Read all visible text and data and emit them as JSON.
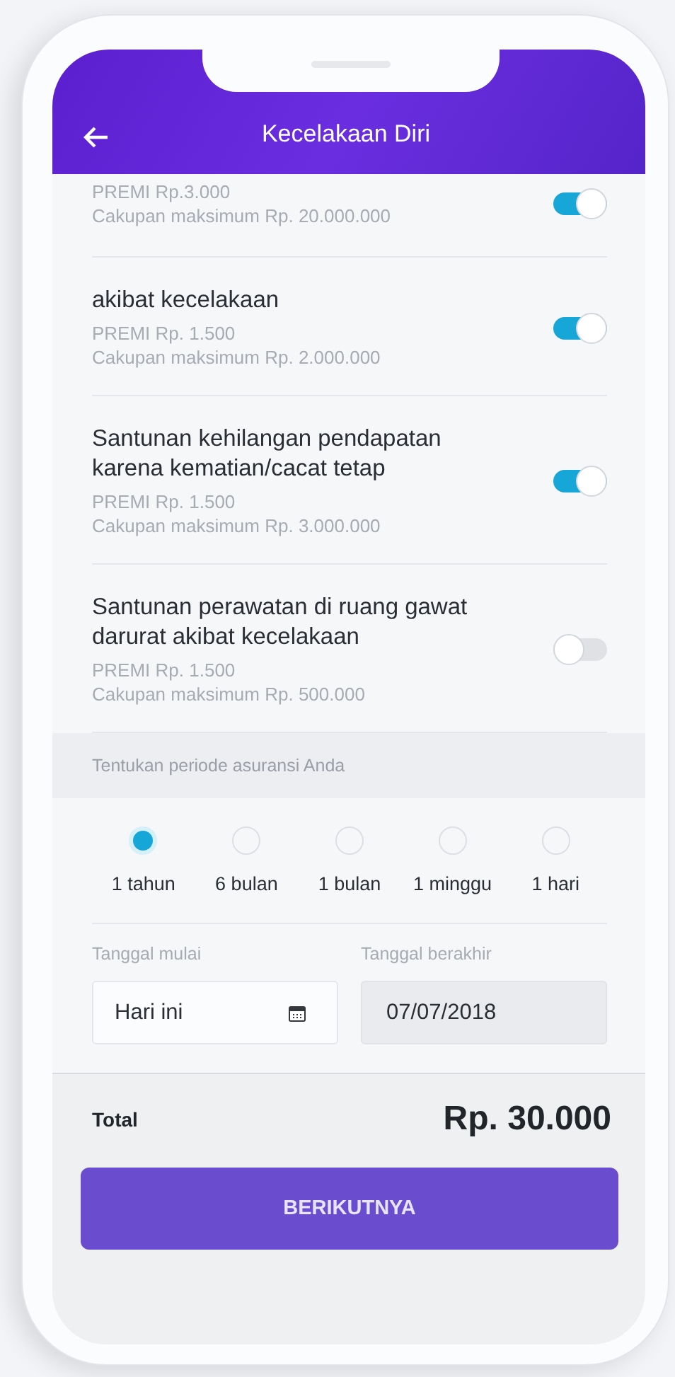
{
  "header": {
    "title": "Kecelakaan Diri"
  },
  "coverages": [
    {
      "premium": "PREMI Rp.3.000",
      "coverage": "Cakupan maksimum Rp. 20.000.000",
      "on": true
    },
    {
      "title": "akibat kecelakaan",
      "premium": "PREMI Rp. 1.500",
      "coverage": "Cakupan maksimum Rp. 2.000.000",
      "on": true
    },
    {
      "title": "Santunan kehilangan pendapatan karena kematian/cacat tetap",
      "premium": "PREMI Rp. 1.500",
      "coverage": "Cakupan maksimum Rp. 3.000.000",
      "on": true
    },
    {
      "title": "Santunan perawatan di ruang gawat darurat akibat kecelakaan",
      "premium": "PREMI Rp. 1.500",
      "coverage": "Cakupan maksimum Rp. 500.000",
      "on": false
    }
  ],
  "period": {
    "label": "Tentukan periode asuransi Anda",
    "options": [
      {
        "label": "1 tahun",
        "selected": true
      },
      {
        "label": "6 bulan",
        "selected": false
      },
      {
        "label": "1 bulan",
        "selected": false
      },
      {
        "label": "1 minggu",
        "selected": false
      },
      {
        "label": "1 hari",
        "selected": false
      }
    ]
  },
  "dates": [
    {
      "label": "Tanggal mulai",
      "value": "Hari ini",
      "kind": "picker",
      "disabled": false
    },
    {
      "label": "Tanggal berakhir",
      "value": "07/07/2018",
      "kind": "text",
      "disabled": true
    }
  ],
  "total": {
    "label": "Total",
    "amount": "Rp. 30.000"
  },
  "button": "BERIKUTNYA"
}
